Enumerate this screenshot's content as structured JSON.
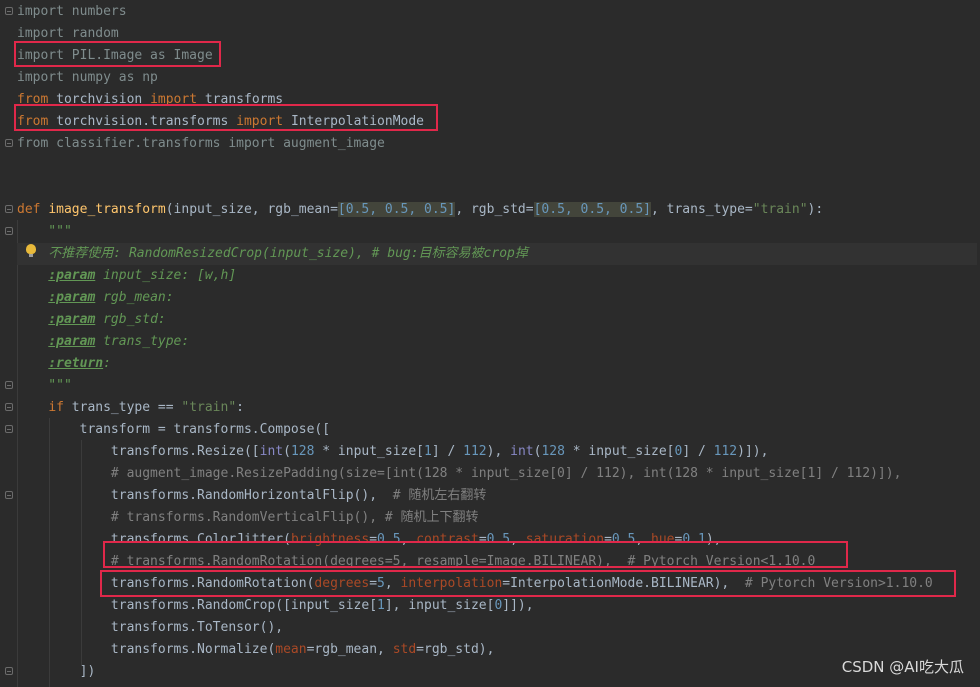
{
  "editor": {
    "lines": [
      {
        "t": [
          [
            "dim",
            "import numbers"
          ]
        ]
      },
      {
        "t": [
          [
            "dim",
            "import random"
          ]
        ]
      },
      {
        "t": [
          [
            "dim",
            "import PIL.Image as Image"
          ]
        ]
      },
      {
        "t": [
          [
            "dim",
            "import numpy as np"
          ]
        ]
      },
      {
        "t": [
          [
            "kw",
            "from "
          ],
          [
            "plain",
            "torchvision "
          ],
          [
            "kw",
            "import "
          ],
          [
            "plain",
            "transforms"
          ]
        ]
      },
      {
        "t": [
          [
            "kw",
            "from "
          ],
          [
            "plain",
            "torchvision.transforms "
          ],
          [
            "kw",
            "import "
          ],
          [
            "plain",
            "InterpolationMode"
          ]
        ]
      },
      {
        "t": [
          [
            "dim",
            "from classifier.transforms import augment_image"
          ]
        ]
      },
      {
        "t": []
      },
      {
        "t": []
      },
      {
        "t": [
          [
            "kw",
            "def "
          ],
          [
            "fn",
            "image_transform"
          ],
          [
            "plain",
            "(input_size, rgb_mean="
          ],
          [
            "box",
            "[0.5, 0.5, 0.5]"
          ],
          [
            "plain",
            ", rgb_std="
          ],
          [
            "box",
            "[0.5, 0.5, 0.5]"
          ],
          [
            "plain",
            ", trans_type="
          ],
          [
            "str",
            "\"train\""
          ],
          [
            "plain",
            "):"
          ]
        ]
      },
      {
        "t": [
          [
            "doc",
            "    \"\"\""
          ]
        ]
      },
      {
        "t": [
          [
            "doc",
            "    不推荐使用: RandomResizedCrop(input_size), # bug:目标容易被crop掉"
          ]
        ],
        "current": true
      },
      {
        "t": [
          [
            "doc",
            "    "
          ],
          [
            "tag",
            ":param"
          ],
          [
            "doc",
            " input_size: [w,h]"
          ]
        ]
      },
      {
        "t": [
          [
            "doc",
            "    "
          ],
          [
            "tag",
            ":param"
          ],
          [
            "doc",
            " rgb_mean:"
          ]
        ]
      },
      {
        "t": [
          [
            "doc",
            "    "
          ],
          [
            "tag",
            ":param"
          ],
          [
            "doc",
            " rgb_std:"
          ]
        ]
      },
      {
        "t": [
          [
            "doc",
            "    "
          ],
          [
            "tag",
            ":param"
          ],
          [
            "doc",
            " trans_type:"
          ]
        ]
      },
      {
        "t": [
          [
            "doc",
            "    "
          ],
          [
            "tag",
            ":return"
          ],
          [
            "doc",
            ":"
          ]
        ]
      },
      {
        "t": [
          [
            "doc",
            "    \"\"\""
          ]
        ]
      },
      {
        "t": [
          [
            "plain",
            "    "
          ],
          [
            "kw",
            "if "
          ],
          [
            "plain",
            "trans_type == "
          ],
          [
            "str",
            "\"train\""
          ],
          [
            "plain",
            ":"
          ]
        ]
      },
      {
        "t": [
          [
            "plain",
            "        transform = transforms.Compose(["
          ]
        ]
      },
      {
        "t": [
          [
            "plain",
            "            transforms.Resize(["
          ],
          [
            "builtin",
            "int"
          ],
          [
            "plain",
            "("
          ],
          [
            "num",
            "128"
          ],
          [
            "plain",
            " * input_size["
          ],
          [
            "num",
            "1"
          ],
          [
            "plain",
            "] / "
          ],
          [
            "num",
            "112"
          ],
          [
            "plain",
            "), "
          ],
          [
            "builtin",
            "int"
          ],
          [
            "plain",
            "("
          ],
          [
            "num",
            "128"
          ],
          [
            "plain",
            " * input_size["
          ],
          [
            "num",
            "0"
          ],
          [
            "plain",
            "] / "
          ],
          [
            "num",
            "112"
          ],
          [
            "plain",
            ")]),"
          ]
        ]
      },
      {
        "t": [
          [
            "cmt",
            "            # augment_image.ResizePadding(size=[int(128 * input_size[0] / 112), int(128 * input_size[1] / 112)]),"
          ]
        ]
      },
      {
        "t": [
          [
            "plain",
            "            transforms.RandomHorizontalFlip(),  "
          ],
          [
            "cmt",
            "# 随机左右翻转"
          ]
        ]
      },
      {
        "t": [
          [
            "cmt",
            "            # transforms.RandomVerticalFlip(), # 随机上下翻转"
          ]
        ]
      },
      {
        "t": [
          [
            "plain",
            "            transforms.ColorJitter("
          ],
          [
            "param",
            "brightness"
          ],
          [
            "plain",
            "="
          ],
          [
            "num",
            "0.5"
          ],
          [
            "plain",
            ", "
          ],
          [
            "param",
            "contrast"
          ],
          [
            "plain",
            "="
          ],
          [
            "num",
            "0.5"
          ],
          [
            "plain",
            ", "
          ],
          [
            "param",
            "saturation"
          ],
          [
            "plain",
            "="
          ],
          [
            "num",
            "0.5"
          ],
          [
            "plain",
            ", "
          ],
          [
            "param",
            "hue"
          ],
          [
            "plain",
            "="
          ],
          [
            "num",
            "0.1"
          ],
          [
            "plain",
            "),"
          ]
        ]
      },
      {
        "t": [
          [
            "cmt",
            "            # transforms.RandomRotation(degrees=5, resample=Image.BILINEAR),  # Pytorch Version<1.10.0"
          ]
        ]
      },
      {
        "t": [
          [
            "plain",
            "            transforms.RandomRotation("
          ],
          [
            "param",
            "degrees"
          ],
          [
            "plain",
            "="
          ],
          [
            "num",
            "5"
          ],
          [
            "plain",
            ", "
          ],
          [
            "param",
            "interpolation"
          ],
          [
            "plain",
            "=InterpolationMode.BILINEAR),  "
          ],
          [
            "cmt",
            "# Pytorch Version>1.10.0"
          ]
        ]
      },
      {
        "t": [
          [
            "plain",
            "            transforms.RandomCrop([input_size["
          ],
          [
            "num",
            "1"
          ],
          [
            "plain",
            "], input_size["
          ],
          [
            "num",
            "0"
          ],
          [
            "plain",
            "]]),"
          ]
        ]
      },
      {
        "t": [
          [
            "plain",
            "            transforms.ToTensor(),"
          ]
        ]
      },
      {
        "t": [
          [
            "plain",
            "            transforms.Normalize("
          ],
          [
            "param",
            "mean"
          ],
          [
            "plain",
            "=rgb_mean, "
          ],
          [
            "param",
            "std"
          ],
          [
            "plain",
            "=rgb_std),"
          ]
        ]
      },
      {
        "t": [
          [
            "plain",
            "        ])"
          ]
        ]
      }
    ]
  },
  "colors": {
    "background": "#2b2b2b",
    "current_line": "#323232",
    "highlight_box": "#e0284a"
  },
  "icons": {
    "fold_marker": "fold-marker-icon",
    "intention_bulb": "lightbulb-icon"
  },
  "watermark": {
    "text": "CSDN @AI吃大瓜"
  }
}
